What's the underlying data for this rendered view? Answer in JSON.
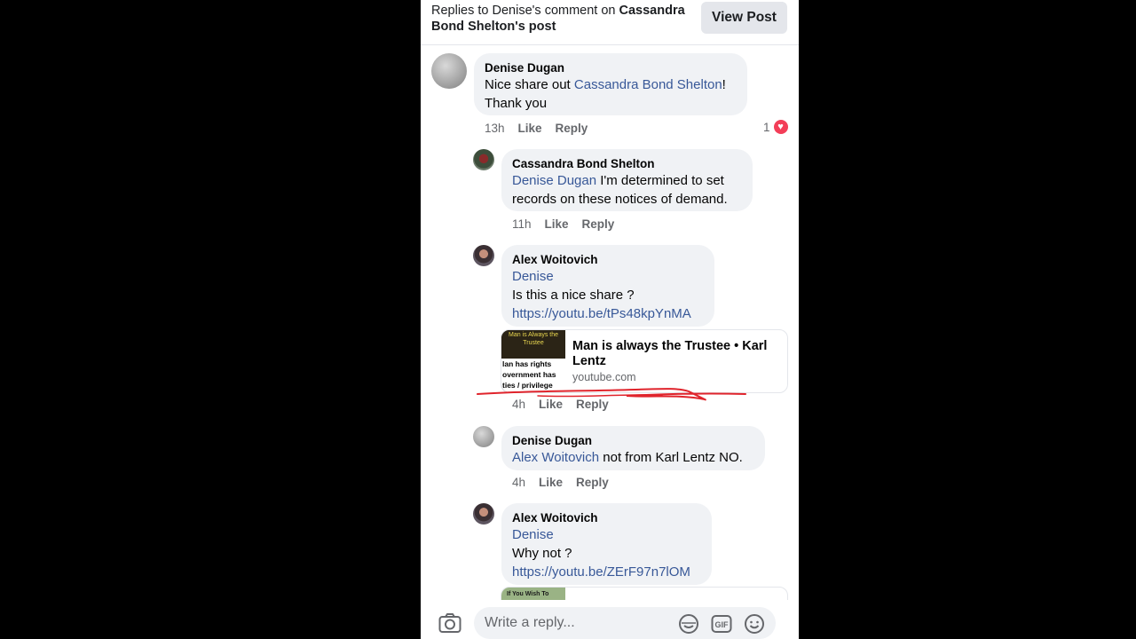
{
  "header": {
    "title_prefix": "Replies to Denise's comment on ",
    "title_author": "Cassandra Bond Shelton",
    "title_suffix": "'s post",
    "view_post_label": "View Post"
  },
  "comments": [
    {
      "author": "Denise Dugan",
      "text_before": "Nice share out ",
      "mention": "Cassandra Bond Shelton",
      "text_after_line1": "!",
      "text_line2": "Thank you",
      "time": "13h",
      "like": "Like",
      "reply": "Reply",
      "reaction_count": "1"
    },
    {
      "author": "Cassandra Bond Shelton",
      "mention": "Denise Dugan",
      "text_line1": " I'm determined to set",
      "text_line2": "records on these notices of demand.",
      "time": "11h",
      "like": "Like",
      "reply": "Reply"
    },
    {
      "author": "Alex Woitovich",
      "mention": "Denise",
      "text": "Is this a nice share ?",
      "link": "https://youtu.be/tPs48kpYnMA",
      "preview_title": "Man is always the Trustee • Karl Lentz",
      "preview_source": "youtube.com",
      "thumb_top": "Man is Always the Trustee",
      "thumb_lines": [
        "lan has rights",
        "overnment has",
        "ties / privilege"
      ],
      "time": "4h",
      "like": "Like",
      "reply": "Reply"
    },
    {
      "author": "Denise Dugan",
      "mention": "Alex Woitovich",
      "text": " not from Karl Lentz NO.",
      "time": "4h",
      "like": "Like",
      "reply": "Reply"
    },
    {
      "author": "Alex Woitovich",
      "mention": "Denise",
      "text": "Why not ?",
      "link": "https://youtu.be/ZErF97n7lOM",
      "thumb_text": "If You Wish To"
    }
  ],
  "composer": {
    "placeholder": "Write a reply...",
    "icons": [
      "camera-icon",
      "sticker-icon",
      "gif-icon",
      "emoji-icon"
    ]
  },
  "colors": {
    "link": "#385898",
    "bubble": "#f0f2f5",
    "heart": "#f33e58",
    "scribble": "#e0242c"
  }
}
